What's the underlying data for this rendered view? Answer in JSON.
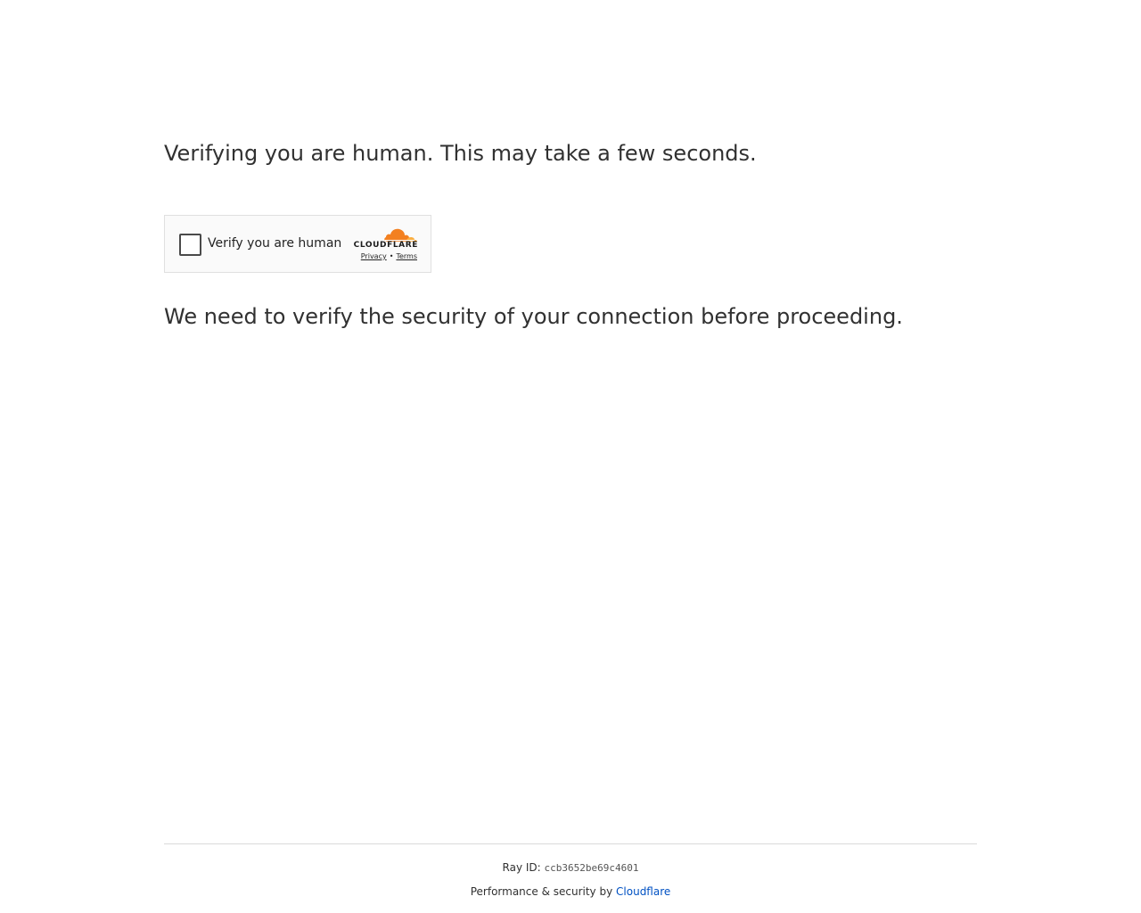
{
  "main": {
    "heading": "Verifying you are human. This may take a few seconds.",
    "subheading": "We need to verify the security of your connection before proceeding."
  },
  "widget": {
    "checkbox_label": "Verify you are human",
    "brand_text": "CLOUDFLARE",
    "privacy_link": "Privacy",
    "separator": "•",
    "terms_link": "Terms",
    "checkbox_checked": false
  },
  "footer": {
    "ray_label": "Ray ID:",
    "ray_id": "ccb3652be69c4601",
    "performance_text": "Performance & security by",
    "cloudflare_link": "Cloudflare"
  },
  "colors": {
    "cloudflare_orange": "#f38020",
    "cloudflare_light_orange": "#faae40",
    "link_blue": "#0051c3"
  },
  "icons": {
    "brand_logo": "cloudflare-cloud-icon"
  }
}
